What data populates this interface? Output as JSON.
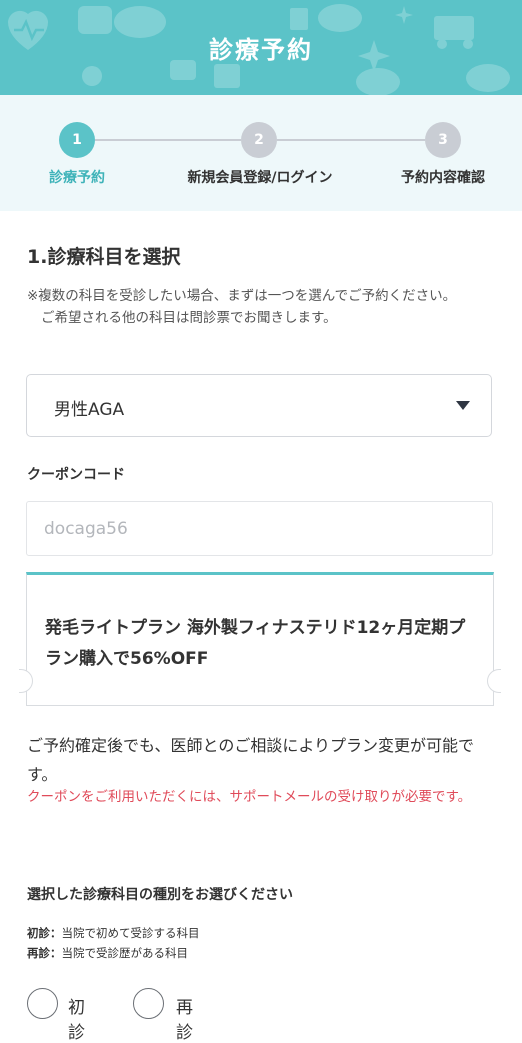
{
  "header": {
    "title": "診療予約"
  },
  "stepper": {
    "steps": [
      {
        "number": "1",
        "label": "診療予約",
        "active": true
      },
      {
        "number": "2",
        "label": "新規会員登録/ログイン",
        "active": false
      },
      {
        "number": "3",
        "label": "予約内容確認",
        "active": false
      }
    ],
    "colors": {
      "active": "#5bc3c8",
      "inactive": "#c9cdd4",
      "active_label": "#3fb3b9",
      "inactive_label": "#333333"
    }
  },
  "department": {
    "title": "1.診療科目を選択",
    "note_line1": "※複数の科目を受診したい場合、まずは一つを選んでご予約ください。",
    "note_line2": "ご希望される他の科目は問診票でお聞きします。",
    "selected": "男性AGA"
  },
  "coupon": {
    "label": "クーポンコード",
    "placeholder": "docaga56",
    "value": "",
    "offer": "発毛ライトプラン 海外製フィナステリド12ヶ月定期プラン購入で56%OFF"
  },
  "info": {
    "text": "ご予約確定後でも、医師とのご相談によりプラン変更が可能です。",
    "warning": "クーポンをご利用いただくには、サポートメールの受け取りが必要です。"
  },
  "visit_type": {
    "title": "選択した診療科目の種別をお選びください",
    "first_term": "初診：",
    "first_desc": "当院で初めて受診する科目",
    "return_term": "再診：",
    "return_desc": "当院で受診歴がある科目",
    "option_first": "初診",
    "option_return": "再診"
  },
  "theme": {
    "accent": "#5bc3c8",
    "warning": "#e04b5a"
  }
}
